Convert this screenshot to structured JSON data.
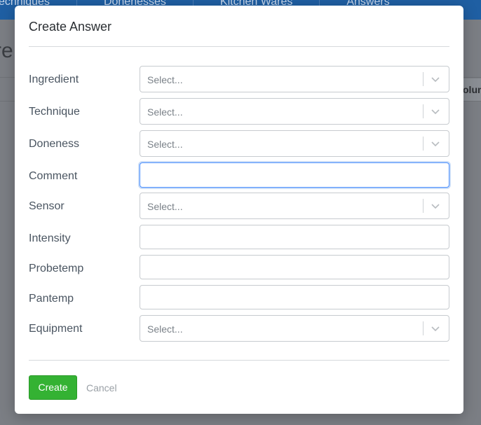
{
  "background": {
    "nav_tabs": [
      "Techniques",
      "Donenesses",
      "Kitchen Wares",
      "Answers"
    ],
    "page_title_fragment": "re",
    "column_fragment": "olum"
  },
  "modal": {
    "title": "Create Answer",
    "fields": [
      {
        "label": "Ingredient",
        "type": "select",
        "placeholder": "Select..."
      },
      {
        "label": "Technique",
        "type": "select",
        "placeholder": "Select..."
      },
      {
        "label": "Doneness",
        "type": "select",
        "placeholder": "Select..."
      },
      {
        "label": "Comment",
        "type": "text",
        "value": ""
      },
      {
        "label": "Sensor",
        "type": "select",
        "placeholder": "Select..."
      },
      {
        "label": "Intensity",
        "type": "text",
        "value": ""
      },
      {
        "label": "Probetemp",
        "type": "text",
        "value": ""
      },
      {
        "label": "Pantemp",
        "type": "text",
        "value": ""
      },
      {
        "label": "Equipment",
        "type": "select",
        "placeholder": "Select..."
      }
    ],
    "create_label": "Create",
    "cancel_label": "Cancel"
  },
  "colors": {
    "primary_button": "#34b233",
    "focus_ring": "#4d90fe",
    "nav_bar": "#1f5fa3"
  }
}
